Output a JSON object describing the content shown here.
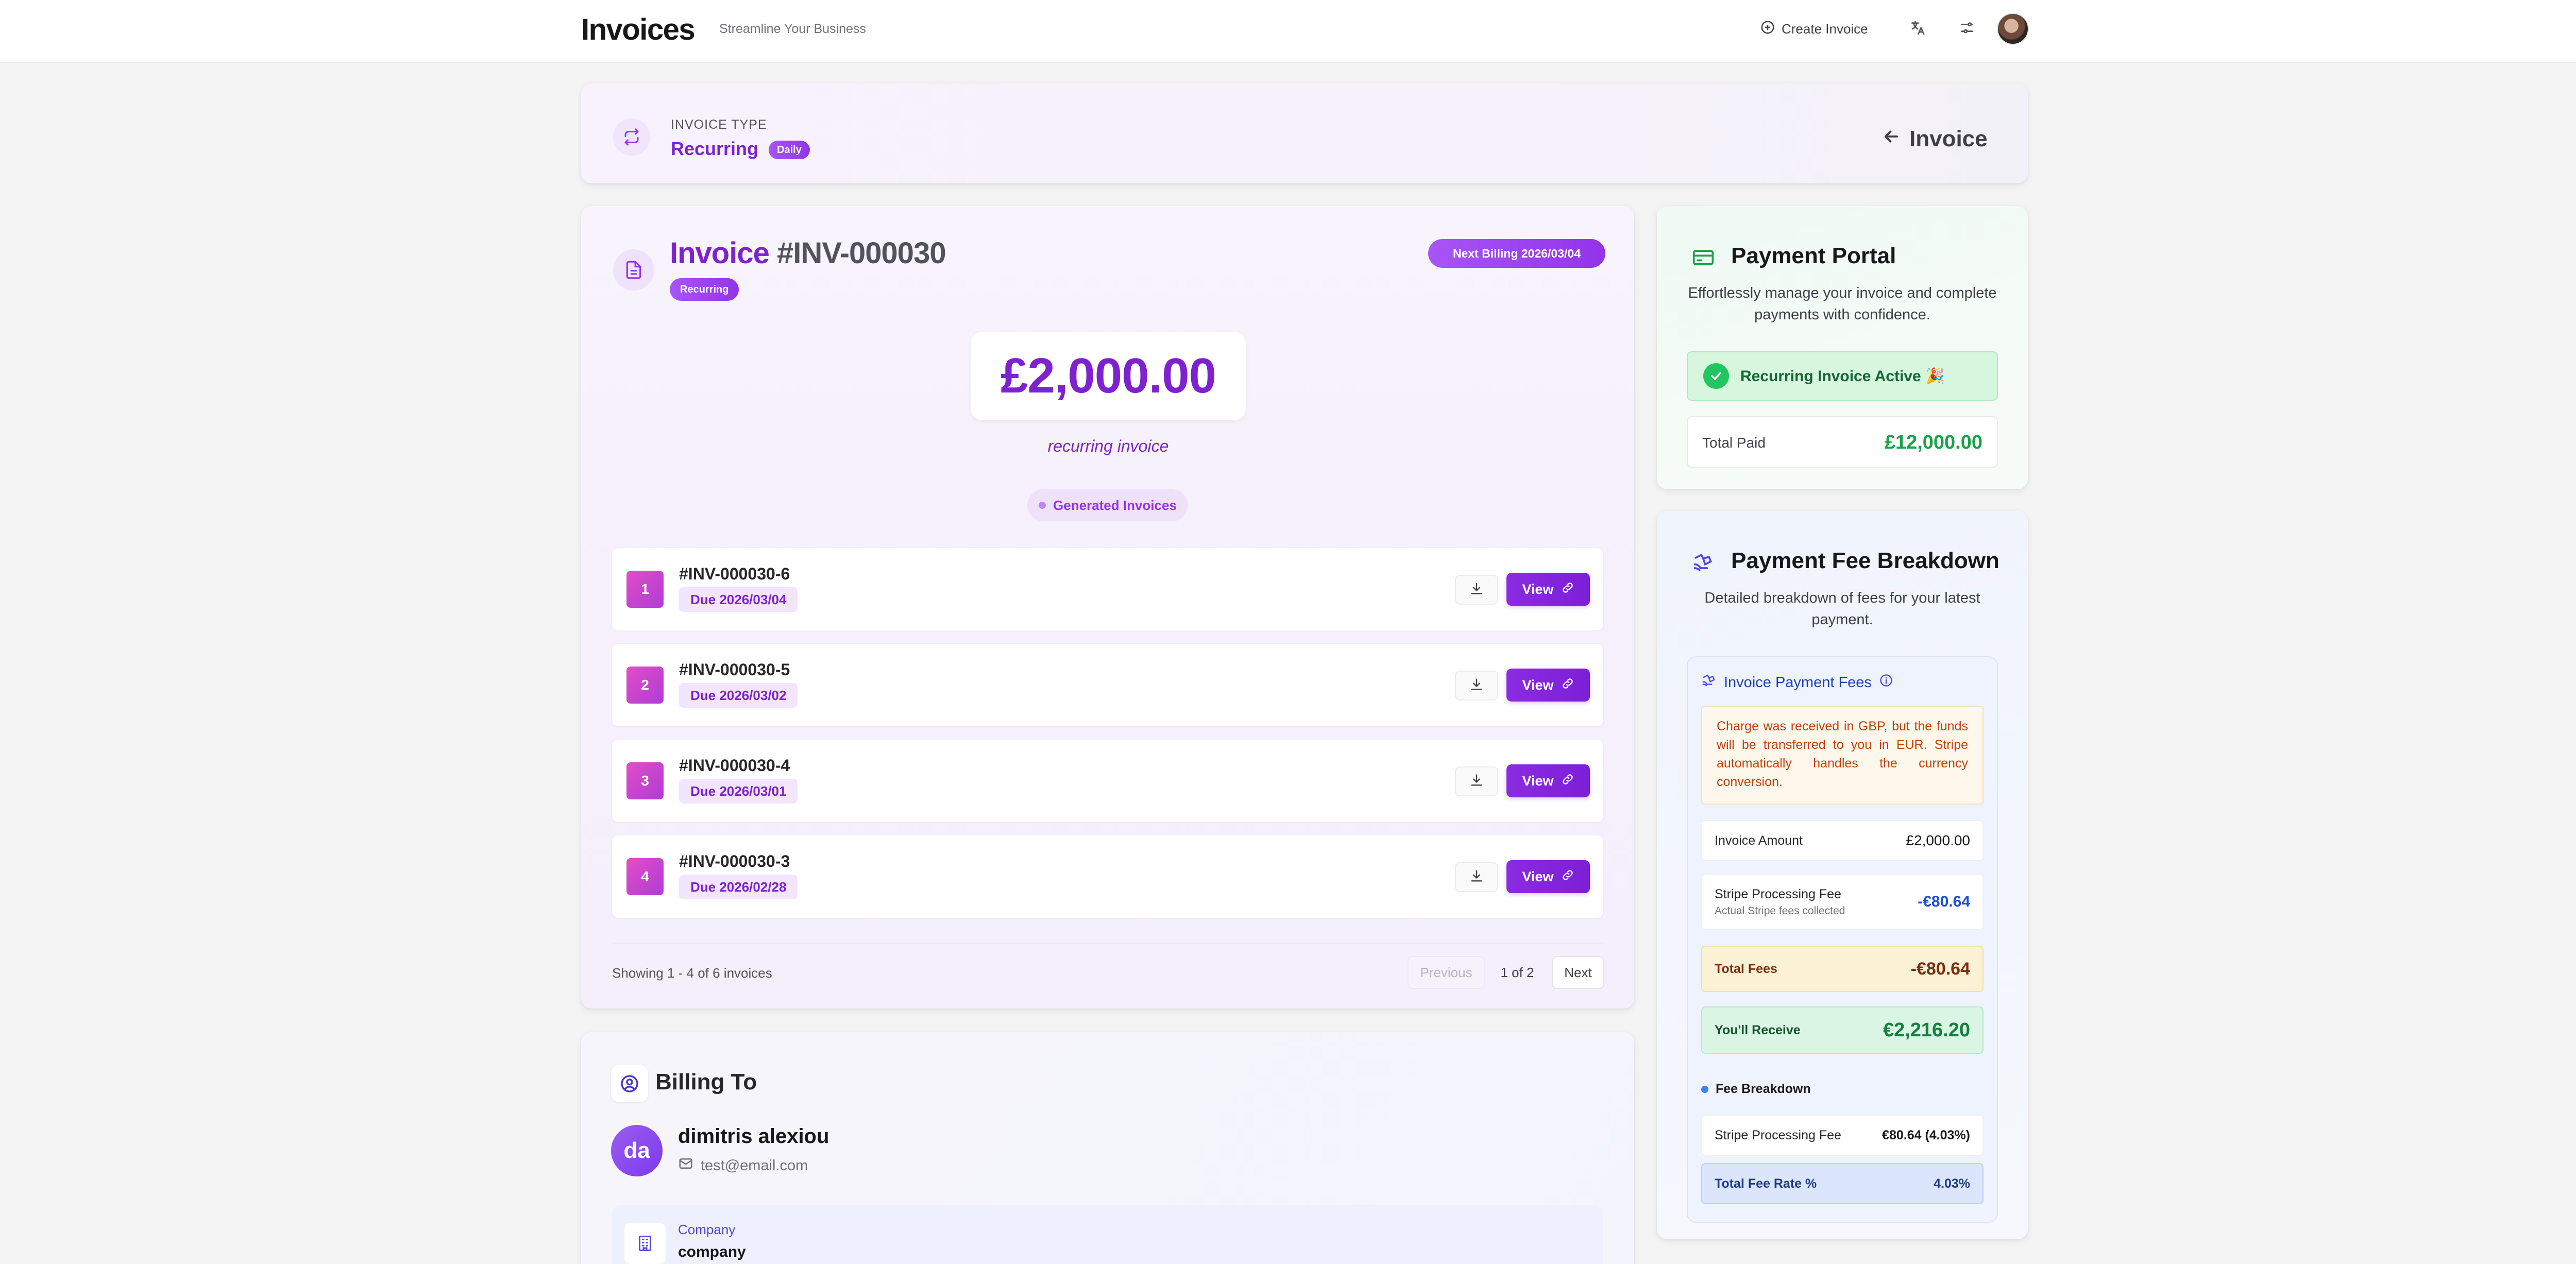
{
  "header": {
    "title": "Invoices",
    "tagline": "Streamline Your Business",
    "create_label": "Create Invoice"
  },
  "invoice_type": {
    "label": "INVOICE TYPE",
    "value": "Recurring",
    "badge": "Daily",
    "back_label": "Invoice"
  },
  "invoice": {
    "title_word": "Invoice",
    "number": "#INV-000030",
    "status_badge": "Recurring",
    "next_billing": "Next Billing 2026/03/04",
    "amount": "£2,000.00",
    "amount_caption": "recurring invoice",
    "generated_label": "Generated Invoices",
    "rows": [
      {
        "index": "1",
        "id": "#INV-000030-6",
        "due": "Due 2026/03/04",
        "view": "View"
      },
      {
        "index": "2",
        "id": "#INV-000030-5",
        "due": "Due 2026/03/02",
        "view": "View"
      },
      {
        "index": "3",
        "id": "#INV-000030-4",
        "due": "Due 2026/03/01",
        "view": "View"
      },
      {
        "index": "4",
        "id": "#INV-000030-3",
        "due": "Due 2026/02/28",
        "view": "View"
      }
    ],
    "showing": "Showing 1 - 4 of 6 invoices",
    "pager": {
      "previous": "Previous",
      "page": "1 of 2",
      "next": "Next"
    }
  },
  "billing": {
    "title": "Billing To",
    "initials": "da",
    "name": "dimitris alexiou",
    "email": "test@email.com",
    "company_label": "Company",
    "company_value": "company"
  },
  "portal": {
    "title": "Payment Portal",
    "description": "Effortlessly manage your invoice and complete payments with confidence.",
    "active_text": "Recurring Invoice Active 🎉",
    "total_paid_label": "Total Paid",
    "total_paid_value": "£12,000.00"
  },
  "fees": {
    "title": "Payment Fee Breakdown",
    "description": "Detailed breakdown of fees for your latest payment.",
    "section_title": "Invoice Payment Fees",
    "notice": "Charge was received in GBP, but the funds will be transferred to you in EUR. Stripe automatically handles the currency conversion.",
    "invoice_amount_label": "Invoice Amount",
    "invoice_amount_value": "£2,000.00",
    "stripe_fee_label": "Stripe Processing Fee",
    "stripe_fee_sub": "Actual Stripe fees collected",
    "stripe_fee_value": "-€80.64",
    "total_fees_label": "Total Fees",
    "total_fees_value": "-€80.64",
    "receive_label": "You'll Receive",
    "receive_value": "€2,216.20",
    "breakdown_title": "Fee Breakdown",
    "breakdown_stripe_label": "Stripe Processing Fee",
    "breakdown_stripe_value": "€80.64 (4.03%)",
    "rate_label": "Total Fee Rate %",
    "rate_value": "4.03%"
  },
  "colors": {
    "brand_purple": "#7e22ce",
    "success_green": "#16a34a",
    "fee_blue": "#1d4ed8"
  },
  "icons": [
    "plus-circle-icon",
    "translate-icon",
    "settings-sliders-icon",
    "repeat-icon",
    "arrow-left-icon",
    "document-icon",
    "download-icon",
    "link-icon",
    "user-circle-icon",
    "mail-icon",
    "building-icon",
    "credit-card-icon",
    "check-icon",
    "coins-icon",
    "info-icon"
  ]
}
